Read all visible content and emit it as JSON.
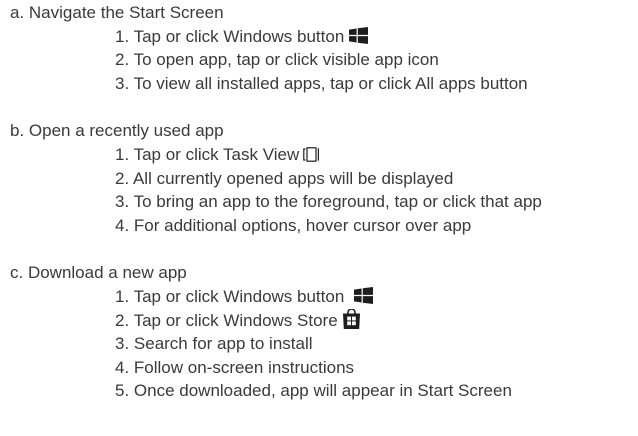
{
  "sections": [
    {
      "title": "a. Navigate the Start Screen",
      "steps": [
        {
          "text": "1. Tap or click Windows button",
          "icon": "windows-logo-icon"
        },
        {
          "text": "2. To open app, tap or click visible app icon"
        },
        {
          "text": "3. To view all installed apps, tap or click All apps button"
        }
      ]
    },
    {
      "title": "b. Open a recently used app",
      "steps": [
        {
          "text": "1. Tap or click Task View",
          "icon": "task-view-icon"
        },
        {
          "text": "2. All currently opened apps will be displayed"
        },
        {
          "text": "3. To bring an app to the foreground, tap or click that app"
        },
        {
          "text": "4. For additional options, hover cursor over app"
        }
      ]
    },
    {
      "title": "c. Download a new app",
      "steps": [
        {
          "text": "1. Tap or click Windows button",
          "icon": "windows-logo-icon"
        },
        {
          "text": "2. Tap or click Windows Store",
          "icon": "windows-store-icon"
        },
        {
          "text": "3. Search for app to install"
        },
        {
          "text": "4. Follow on-screen instructions"
        },
        {
          "text": "5. Once downloaded, app will appear in Start Screen"
        }
      ]
    }
  ],
  "colors": {
    "text": "#3a3a3a",
    "icon": "#1e1e1e"
  }
}
